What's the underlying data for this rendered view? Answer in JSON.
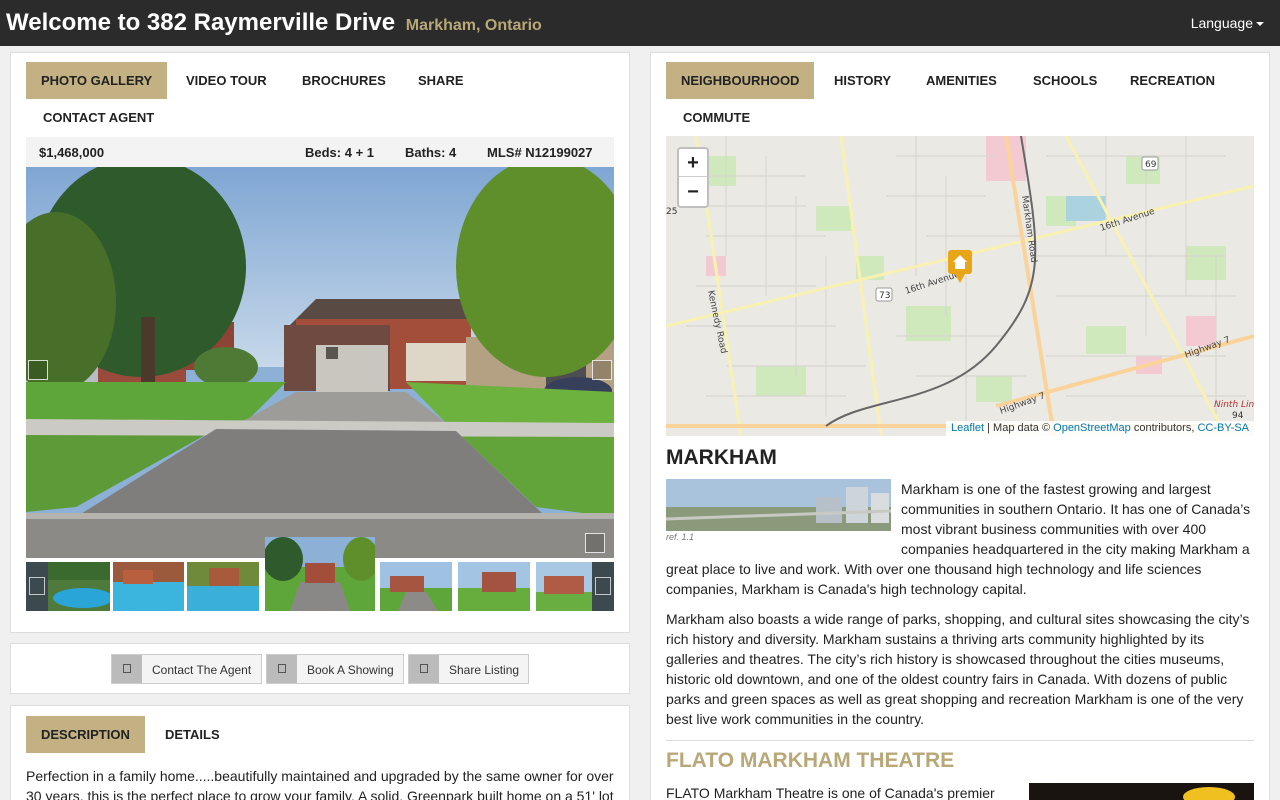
{
  "header": {
    "title": "Welcome to 382 Raymerville Drive",
    "location": "Markham, Ontario",
    "language_label": "Language"
  },
  "gallery_tabs": [
    "PHOTO GALLERY",
    "VIDEO TOUR",
    "BROCHURES",
    "SHARE",
    "CONTACT AGENT"
  ],
  "listing": {
    "price": "$1,468,000",
    "beds": "Beds: 4 + 1",
    "baths": "Baths: 4",
    "mls": "MLS# N12199027"
  },
  "actions": {
    "contact": "Contact The Agent",
    "showing": "Book A Showing",
    "share": "Share Listing"
  },
  "description_tabs": [
    "DESCRIPTION",
    "DETAILS"
  ],
  "description_text": "Perfection in a family home.....beautifully maintained and upgraded by the same owner for over 30 years, this is the perfect place to grow your family. A solid, Greenpark built home on a 51' lot",
  "neighbourhood_tabs": [
    "NEIGHBOURHOOD",
    "HISTORY",
    "AMENITIES",
    "SCHOOLS",
    "RECREATION",
    "COMMUTE"
  ],
  "map": {
    "zoom_in": "+",
    "zoom_out": "−",
    "attribution_leaflet": "Leaflet",
    "attribution_mid": " | Map data © ",
    "attribution_osm": "OpenStreetMap",
    "attribution_contrib": " contributors, ",
    "attribution_license": "CC-BY-SA",
    "labels": {
      "markham_road": "Markham Road",
      "sixteenth_ave_east": "16th Avenue",
      "sixteenth_ave_mid": "16th Avenue",
      "kennedy_road": "Kennedy Road",
      "highway_7_east": "Highway 7",
      "highway_7_south": "Highway 7",
      "ninth_line": "Ninth Lin",
      "road_69": "69",
      "road_73": "73",
      "road_25": "25",
      "road_94": "94"
    }
  },
  "markham": {
    "heading": "MARKHAM",
    "figure_caption": "ref. 1.1",
    "para1_lines": [
      "Markham is one of the fastest growing and largest",
      "communities in southern Ontario. It has one of Canada’s",
      "most vibrant business communities with over 400",
      "companies headquartered in the city making Markham a",
      "great place to live and work. With over one thousand high technology and life sciences",
      "companies, Markham is Canada's high technology capital."
    ],
    "para2_lines": [
      "Markham also boasts a wide range of parks, shopping, and cultural sites showcasing the city’s",
      "rich history and diversity. Markham sustains a thriving arts community highlighted by its",
      "galleries and theatres. The city’s rich history is showcased throughout the cities museums,",
      "historic old downtown, and one of the oldest country fairs in Canada. With dozens of public",
      "parks and green spaces as well as great shopping and recreation Markham is one of the very",
      "best live work communities in the country."
    ]
  },
  "theatre": {
    "heading": "FLATO MARKHAM THEATRE",
    "text": "FLATO Markham Theatre is one of Canada's premier"
  },
  "colors": {
    "accent": "#c3b184",
    "header_bg": "#2b2b2b",
    "link": "#0078a8",
    "marker": "#e8a517"
  }
}
